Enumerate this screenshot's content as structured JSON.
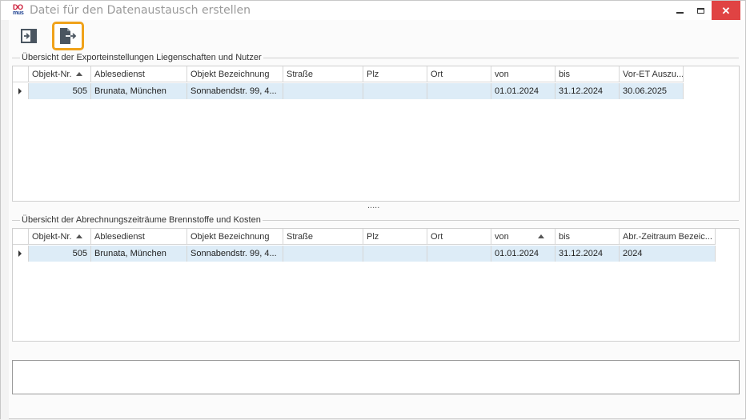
{
  "window": {
    "title": "Datei für den Datenaustausch erstellen",
    "logo_line1": "DO",
    "logo_line2": "mus",
    "close_glyph": "✕"
  },
  "toolbar": {
    "import_icon": "import-icon",
    "export_icon": "export-icon",
    "accent": "#f0a21a"
  },
  "export_settings": {
    "group_label": "Übersicht der Exporteinstellungen Liegenschaften und Nutzer",
    "columns": [
      "Objekt-Nr.",
      "Ablesedienst",
      "Objekt Bezeichnung",
      "Straße",
      "Plz",
      "Ort",
      "von",
      "bis",
      "Vor-ET Auszu..."
    ],
    "sorted_column": "Objekt-Nr.",
    "rows": [
      [
        "505",
        "Brunata, München",
        "Sonnabendstr. 99, 4...",
        "",
        "",
        "",
        "01.01.2024",
        "31.12.2024",
        "30.06.2025"
      ]
    ]
  },
  "billing_periods": {
    "group_label": "Übersicht der Abrechnungszeiträume Brennstoffe und Kosten",
    "columns": [
      "Objekt-Nr.",
      "Ablesedienst",
      "Objekt Bezeichnung",
      "Straße",
      "Plz",
      "Ort",
      "von",
      "bis",
      "Abr.-Zeitraum Bezeic..."
    ],
    "sorted_columns": [
      "Objekt-Nr.",
      "von"
    ],
    "rows": [
      [
        "505",
        "Brunata, München",
        "Sonnabendstr. 99, 4...",
        "",
        "",
        "",
        "01.01.2024",
        "31.12.2024",
        "2024"
      ]
    ]
  },
  "splitter": {
    "glyph": "....."
  },
  "colors": {
    "selected_row": "#ddecf7",
    "close_button": "#e04343"
  }
}
